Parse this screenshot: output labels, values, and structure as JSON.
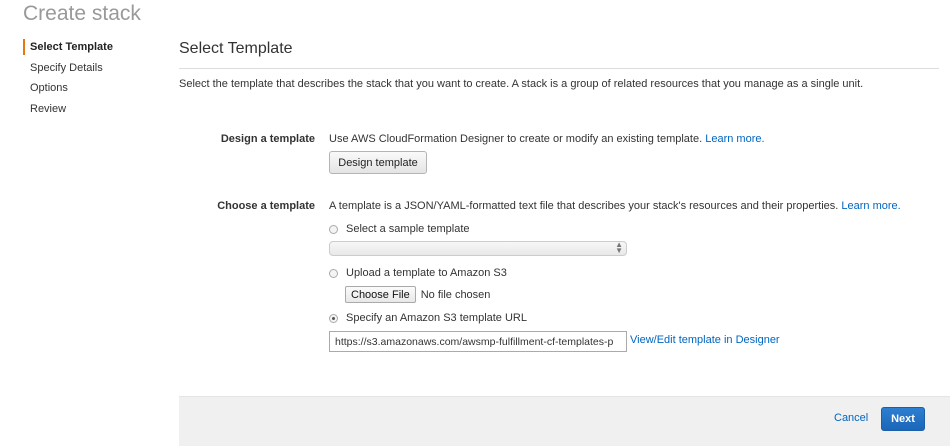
{
  "page": {
    "title": "Create stack"
  },
  "wizard": {
    "steps": [
      {
        "label": "Select Template",
        "active": true
      },
      {
        "label": "Specify Details",
        "active": false
      },
      {
        "label": "Options",
        "active": false
      },
      {
        "label": "Review",
        "active": false
      }
    ]
  },
  "section": {
    "title": "Select Template",
    "intro": "Select the template that describes the stack that you want to create. A stack is a group of related resources that you manage as a single unit."
  },
  "design": {
    "label": "Design a template",
    "description": "Use AWS CloudFormation Designer to create or modify an existing template.",
    "learn_more": "Learn more.",
    "button": "Design template"
  },
  "choose": {
    "label": "Choose a template",
    "description": "A template is a JSON/YAML-formatted text file that describes your stack's resources and their properties.",
    "learn_more": "Learn more.",
    "options": {
      "sample": {
        "label": "Select a sample template",
        "selected_value": "",
        "checked": false
      },
      "upload": {
        "label": "Upload a template to Amazon S3",
        "file_button": "Choose File",
        "file_status": "No file chosen",
        "checked": false
      },
      "url": {
        "label": "Specify an Amazon S3 template URL",
        "value": "https://s3.amazonaws.com/awsmp-fulfillment-cf-templates-p",
        "designer_link": "View/Edit template in Designer",
        "checked": true
      }
    }
  },
  "footer": {
    "cancel": "Cancel",
    "next": "Next"
  },
  "colors": {
    "accent": "#e47911",
    "link": "#0066c0",
    "primary_button": "#1b66b8"
  }
}
